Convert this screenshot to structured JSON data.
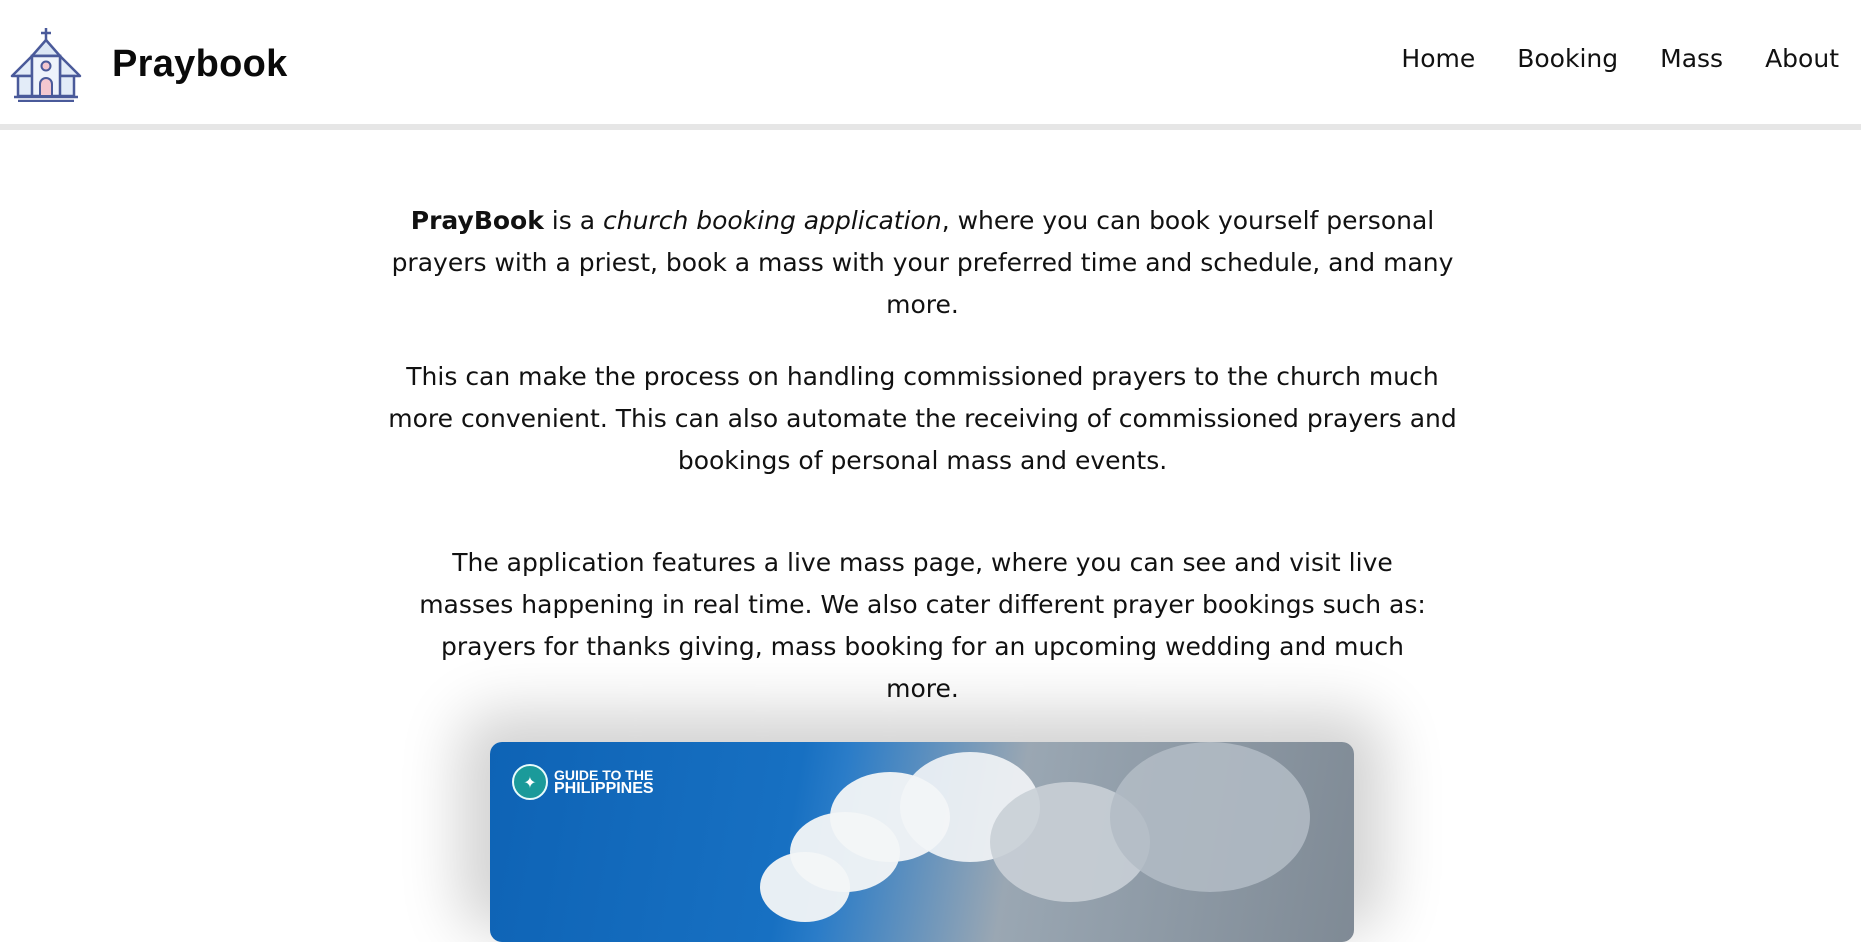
{
  "header": {
    "brand": "Praybook",
    "nav": [
      {
        "label": "Home"
      },
      {
        "label": "Booking"
      },
      {
        "label": "Mass"
      },
      {
        "label": "About"
      }
    ]
  },
  "intro": {
    "p1_bold": "PrayBook",
    "p1_mid": " is a ",
    "p1_italic": "church booking application",
    "p1_rest": ", where you can book yourself personal prayers with a priest, book a mass with your preferred time and schedule, and many more.",
    "p2": "This can make the process on handling commissioned prayers to the church much more convenient. This can also automate the receiving of commissioned prayers and bookings of personal mass and events.",
    "p3": "The application features a live mass page, where you can see and visit live masses happening in real time. We also cater different prayer bookings such as: prayers for thanks giving, mass booking for an upcoming wedding and much more."
  },
  "media": {
    "badge_line1": "GUIDE TO THE",
    "badge_line2": "PHILIPPINES"
  },
  "colors": {
    "header_divider": "#e6e6e6",
    "sky_blue": "#1770c2",
    "badge_teal": "#1b9a9a"
  }
}
